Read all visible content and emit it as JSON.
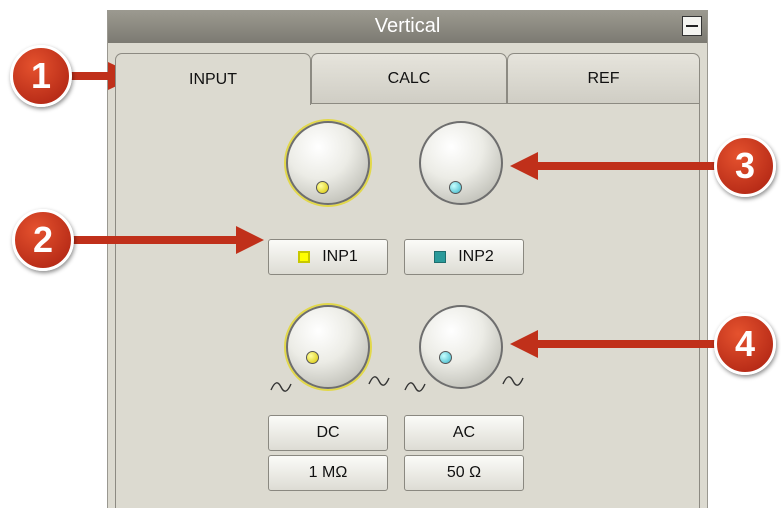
{
  "panel": {
    "title": "Vertical"
  },
  "tabs": [
    {
      "label": "INPUT",
      "active": true
    },
    {
      "label": "CALC",
      "active": false
    },
    {
      "label": "REF",
      "active": false
    }
  ],
  "input_buttons": [
    {
      "label": "INP1",
      "indicator_color": "#ffff00"
    },
    {
      "label": "INP2",
      "indicator_color": "#2a9a9a"
    }
  ],
  "coupling_buttons": [
    {
      "label": "DC"
    },
    {
      "label": "AC"
    }
  ],
  "impedance_buttons": [
    {
      "label": "1 MΩ"
    },
    {
      "label": "50 Ω"
    }
  ],
  "callouts": [
    "1",
    "2",
    "3",
    "4"
  ],
  "colors": {
    "callout": "#c0301a",
    "knob_active_ring": "#e2d84a",
    "input1": "#ffff00",
    "input2": "#2a9a9a"
  }
}
